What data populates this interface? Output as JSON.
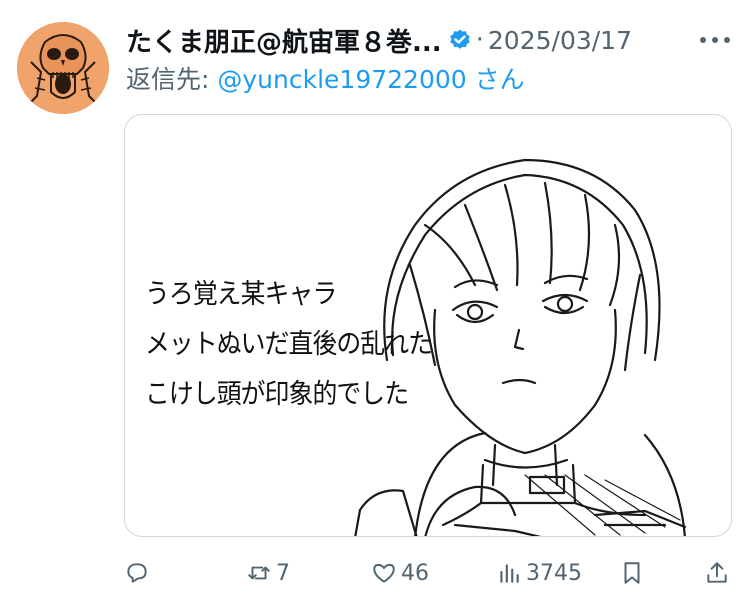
{
  "tweet": {
    "display_name": "たくま朋正@航宙軍８巻...",
    "separator": "·",
    "date": "2025/03/17",
    "reply_label": "返信先: ",
    "reply_handle": "@yunckle19722000",
    "reply_suffix": " さん",
    "image_text": [
      "うろ覚え某キャラ",
      "メットぬいだ直後の乱れた",
      "こけし頭が印象的でした"
    ]
  },
  "actions": {
    "replies": "",
    "retweets": "7",
    "likes": "46",
    "views": "3745"
  },
  "colors": {
    "accent": "#1d9bf0",
    "muted": "#536471",
    "avatar_bg": "#f0a46b"
  },
  "icons": [
    "verified-badge-icon",
    "more-icon",
    "reply-icon",
    "retweet-icon",
    "like-icon",
    "views-icon",
    "bookmark-icon",
    "share-icon"
  ]
}
